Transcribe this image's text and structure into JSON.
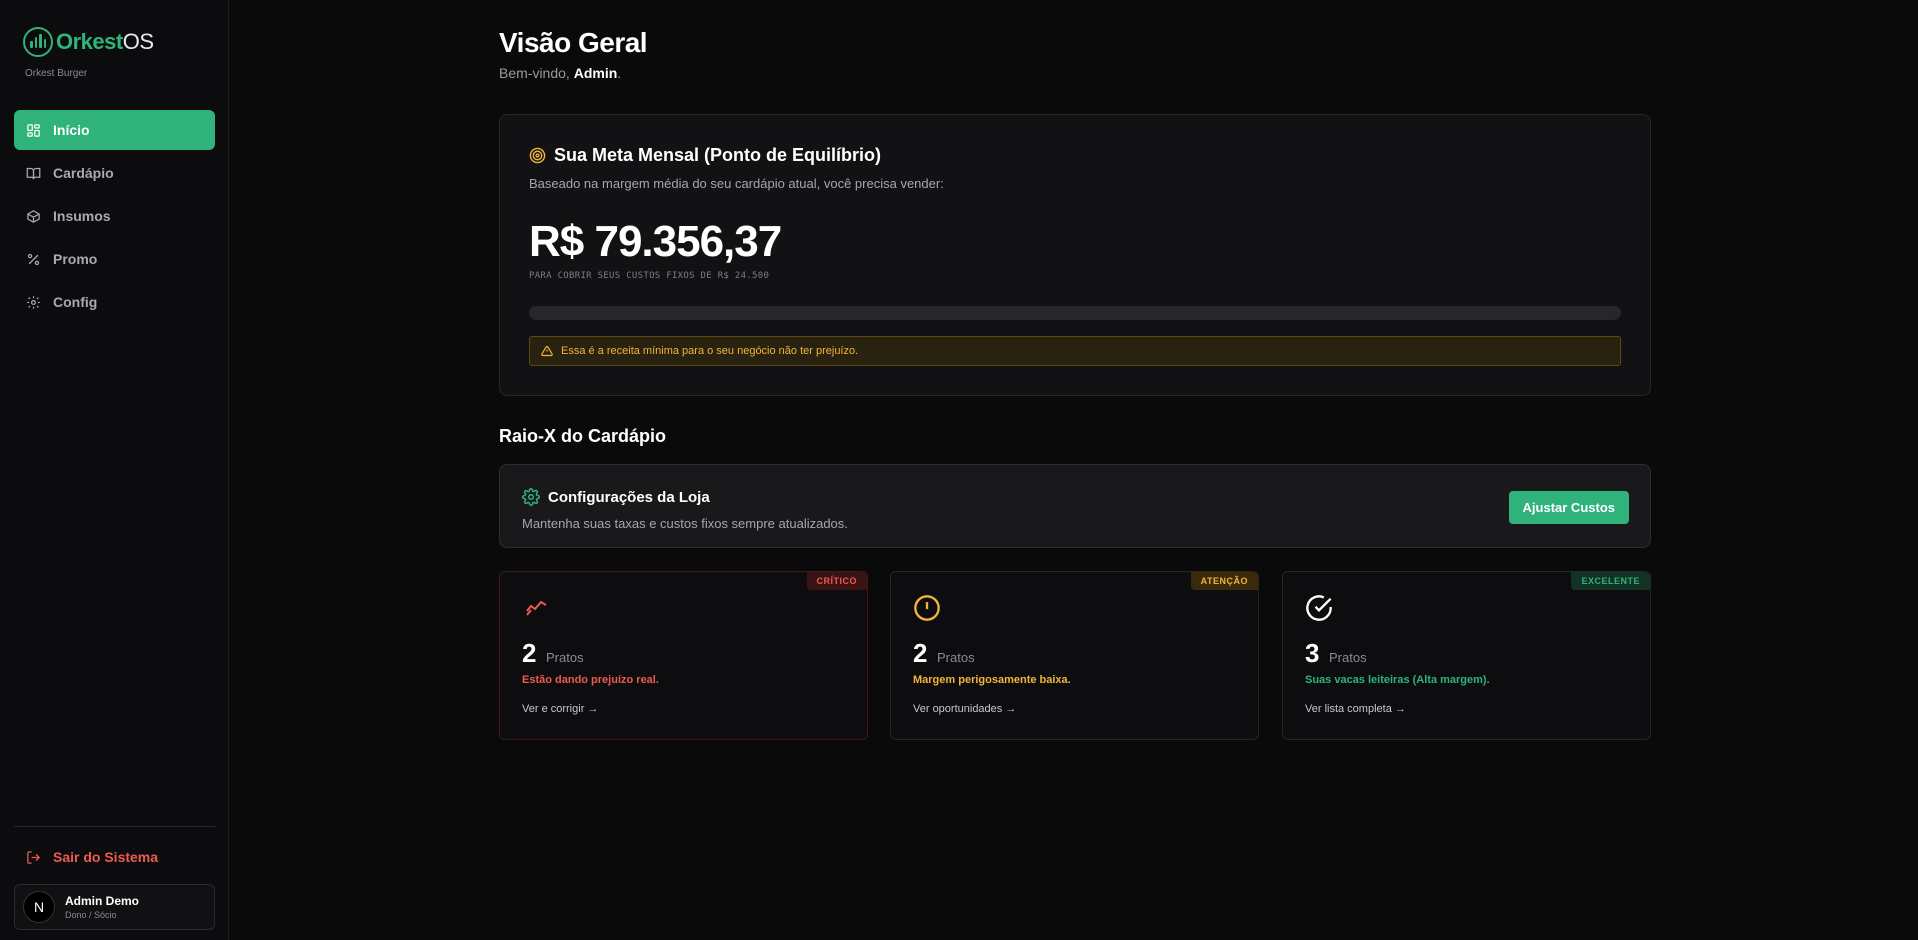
{
  "sidebar": {
    "logo": {
      "part1": "Orkest",
      "part2": "OS"
    },
    "store_name": "Orkest Burger",
    "items": [
      {
        "label": "Início",
        "icon": "grid-icon",
        "active": true
      },
      {
        "label": "Cardápio",
        "icon": "book-icon",
        "active": false
      },
      {
        "label": "Insumos",
        "icon": "package-icon",
        "active": false
      },
      {
        "label": "Promo",
        "icon": "percent-icon",
        "active": false
      },
      {
        "label": "Config",
        "icon": "gear-icon",
        "active": false
      }
    ],
    "logout_label": "Sair do Sistema",
    "user": {
      "avatar_letter": "N",
      "name": "Admin Demo",
      "role": "Dono / Sócio"
    }
  },
  "header": {
    "title": "Visão Geral",
    "welcome_prefix": "Bem-vindo, ",
    "welcome_name": "Admin",
    "welcome_suffix": "."
  },
  "goal": {
    "title": "Sua Meta Mensal (Ponto de Equilíbrio)",
    "description": "Baseado na margem média do seu cardápio atual, você precisa vender:",
    "value": "R$ 79.356,37",
    "subtitle": "PARA COBRIR SEUS CUSTOS FIXOS DE R$ 24.500",
    "progress": 0,
    "warning": "Essa é a receita mínima para o seu negócio não ter prejuízo."
  },
  "xray": {
    "section_title": "Raio-X do Cardápio",
    "config": {
      "title": "Configurações da Loja",
      "description": "Mantenha suas taxas e custos fixos sempre atualizados.",
      "button": "Ajustar Custos"
    },
    "stats": [
      {
        "badge": "CRÍTICO",
        "count": "2",
        "unit": "Pratos",
        "message": "Estão dando prejuízo real.",
        "link": "Ver e corrigir →",
        "icon": "trending-down-icon",
        "color": "#ef5a4f"
      },
      {
        "badge": "ATENÇÃO",
        "count": "2",
        "unit": "Pratos",
        "message": "Margem perigosamente baixa.",
        "link": "Ver oportunidades →",
        "icon": "alert-circle-icon",
        "color": "#f2b53a"
      },
      {
        "badge": "EXCELENTE",
        "count": "3",
        "unit": "Pratos",
        "message": "Suas vacas leiteiras (Alta margem).",
        "link": "Ver lista completa →",
        "icon": "check-circle-icon",
        "color": "#2fb37a"
      }
    ]
  },
  "colors": {
    "accent": "#2fb37a",
    "danger": "#ef5a4f",
    "warning": "#f2b53a",
    "background": "#0a0a0b"
  }
}
